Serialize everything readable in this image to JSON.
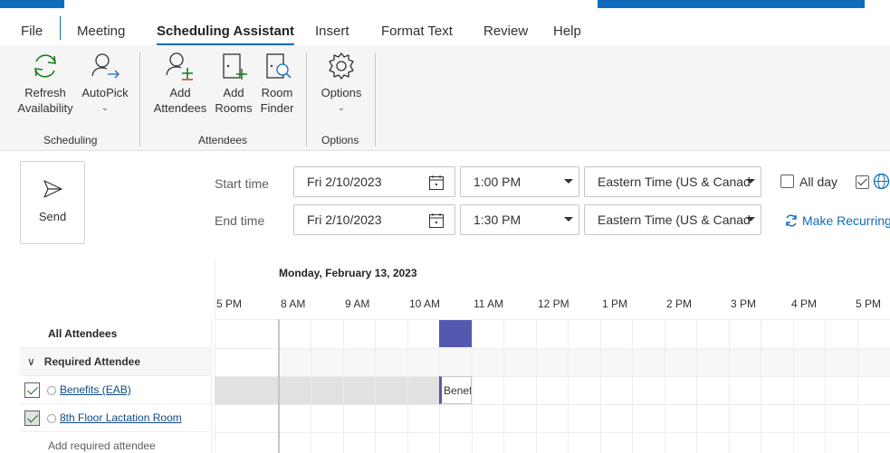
{
  "ribbon_tabs": [
    "File",
    "Meeting",
    "Scheduling Assistant",
    "Insert",
    "Format Text",
    "Review",
    "Help"
  ],
  "ribbon": {
    "refresh_line1": "Refresh",
    "refresh_line2": "Availability",
    "autopick_label": "AutoPick",
    "add_attendees_line1": "Add",
    "add_attendees_line2": "Attendees",
    "add_rooms_line1": "Add",
    "add_rooms_line2": "Rooms",
    "room_finder_line1": "Room",
    "room_finder_line2": "Finder",
    "options_label": "Options",
    "group_scheduling": "Scheduling",
    "group_attendees": "Attendees",
    "group_options": "Options",
    "chevron": "⌄"
  },
  "send": {
    "label": "Send",
    "icon": "send-icon"
  },
  "time": {
    "start_label": "Start time",
    "end_label": "End time",
    "start_date": "Fri 2/10/2023",
    "start_time": "1:00 PM",
    "end_date": "Fri 2/10/2023",
    "end_time": "1:30 PM",
    "start_tz": "Eastern Time (US & Canad",
    "end_tz": "Eastern Time (US & Canad",
    "all_day": "All day",
    "all_day_checked": false,
    "make_recurring": "Make Recurring"
  },
  "schedule": {
    "date_heading": "Monday, February 13, 2023",
    "hours": [
      "5 PM",
      "8 AM",
      "9 AM",
      "10 AM",
      "11 AM",
      "12 PM",
      "1 PM",
      "2 PM",
      "3 PM",
      "4 PM",
      "5 PM"
    ],
    "appointment_text": "Benef"
  },
  "attendees": {
    "all_label": "All Attendees",
    "group_label": "Required Attendee",
    "list": [
      {
        "name": "Benefits (EAB)",
        "checked": true
      },
      {
        "name": "8th Floor Lactation Room",
        "checked": true
      }
    ],
    "add_placeholder": "Add required attendee"
  },
  "colors": {
    "accent": "#0f6cbd",
    "busy": "#5558af",
    "check": "#107c10"
  }
}
